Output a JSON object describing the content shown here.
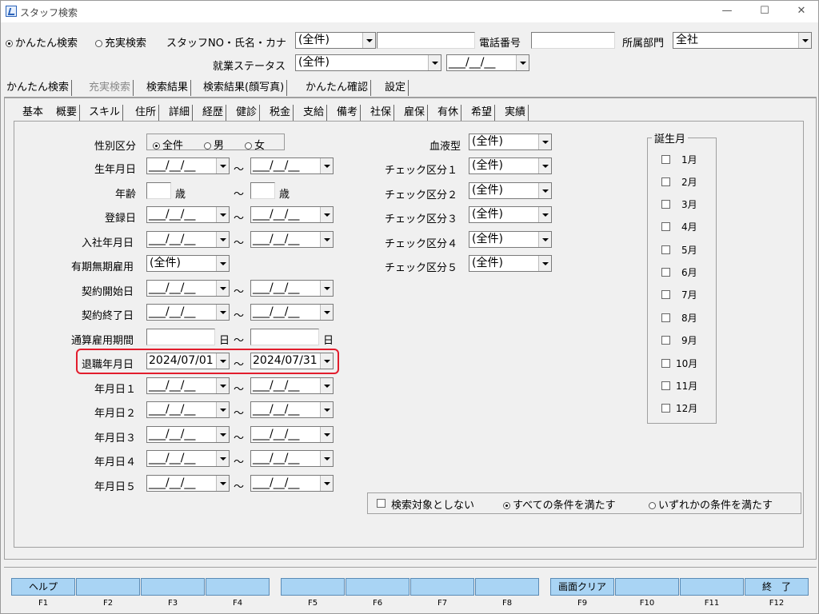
{
  "window": {
    "title": "スタッフ検索",
    "minimize": "—",
    "maximize": "☐",
    "close": "✕"
  },
  "header": {
    "search_simple": "かんたん検索",
    "search_full": "充実検索",
    "staff_label": "スタッフNO・氏名・カナ",
    "staff_combo": "(全件)",
    "staff_value": "",
    "phone_label": "電話番号",
    "phone_value": "",
    "dept_label": "所属部門",
    "dept_value": "全社",
    "status_label": "就業ステータス",
    "status_value": "(全件)",
    "status_date": "___/__/__"
  },
  "main_tabs": [
    "かんたん検索",
    "充実検索",
    "検索結果",
    "検索結果(顔写真)",
    "かんたん確認",
    "設定"
  ],
  "sub_tabs": [
    "基本",
    "概要",
    "スキル",
    "住所",
    "詳細",
    "経歴",
    "健診",
    "税金",
    "支給",
    "備考",
    "社保",
    "雇保",
    "有休",
    "希望",
    "実績"
  ],
  "form": {
    "gender_label": "性別区分",
    "gender_all": "全件",
    "gender_male": "男",
    "gender_female": "女",
    "birth_label": "生年月日",
    "age_label": "年齢",
    "age_unit": "歳",
    "registered_label": "登録日",
    "hire_label": "入社年月日",
    "contract_type_label": "有期無期雇用",
    "contract_type_value": "(全件)",
    "contract_start_label": "契約開始日",
    "contract_end_label": "契約終了日",
    "period_label": "通算雇用期間",
    "day_unit": "日",
    "retire_label": "退職年月日",
    "retire_from": "2024/07/01",
    "retire_to": "2024/07/31",
    "date1_label": "年月日１",
    "date2_label": "年月日２",
    "date3_label": "年月日３",
    "date4_label": "年月日４",
    "date5_label": "年月日５",
    "empty_date": "___/__/__",
    "tilde": "〜",
    "blood_label": "血液型",
    "blood_value": "(全件)",
    "check1_label": "チェック区分１",
    "check2_label": "チェック区分２",
    "check3_label": "チェック区分３",
    "check4_label": "チェック区分４",
    "check5_label": "チェック区分５",
    "check_value": "(全件)"
  },
  "birth_month": {
    "title": "誕生月",
    "months": [
      "1月",
      "2月",
      "3月",
      "4月",
      "5月",
      "6月",
      "7月",
      "8月",
      "9月",
      "10月",
      "11月",
      "12月"
    ]
  },
  "options": {
    "exclude_label": "検索対象としない",
    "all_conditions": "すべての条件を満たす",
    "any_condition": "いずれかの条件を満たす"
  },
  "fkeys": [
    {
      "label": "ヘルプ",
      "key": "F1"
    },
    {
      "label": "",
      "key": "F2"
    },
    {
      "label": "",
      "key": "F3"
    },
    {
      "label": "",
      "key": "F4"
    },
    {
      "label": "",
      "key": "F5"
    },
    {
      "label": "",
      "key": "F6"
    },
    {
      "label": "",
      "key": "F7"
    },
    {
      "label": "",
      "key": "F8"
    },
    {
      "label": "画面クリア",
      "key": "F9"
    },
    {
      "label": "",
      "key": "F10"
    },
    {
      "label": "",
      "key": "F11"
    },
    {
      "label": "終　了",
      "key": "F12"
    }
  ]
}
